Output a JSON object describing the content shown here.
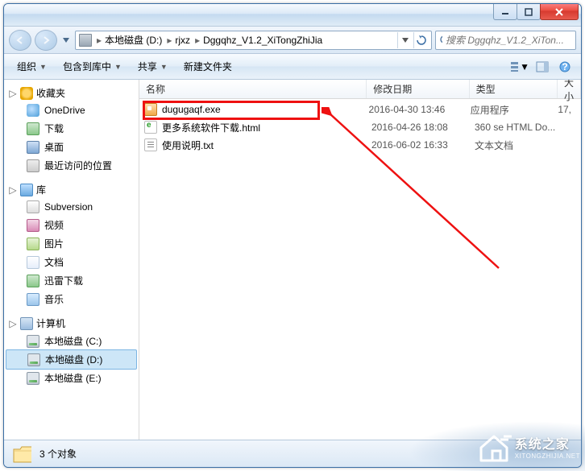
{
  "titlebar": {
    "min": "—",
    "max": "▢",
    "close": "✕"
  },
  "breadcrumbs": [
    "本地磁盘 (D:)",
    "rjxz",
    "Dggqhz_V1.2_XiTongZhiJia"
  ],
  "search": {
    "placeholder": "搜索 Dggqhz_V1.2_XiTon..."
  },
  "toolbar": {
    "organize": "组织",
    "include": "包含到库中",
    "share": "共享",
    "newfolder": "新建文件夹"
  },
  "columns": {
    "name": "名称",
    "date": "修改日期",
    "type": "类型",
    "size": "大小"
  },
  "sidebar": {
    "favorites": {
      "label": "收藏夹",
      "items": [
        {
          "label": "OneDrive",
          "icon": "ic-onedrive"
        },
        {
          "label": "下载",
          "icon": "ic-dl"
        },
        {
          "label": "桌面",
          "icon": "ic-desktop"
        },
        {
          "label": "最近访问的位置",
          "icon": "ic-recent"
        }
      ]
    },
    "libraries": {
      "label": "库",
      "items": [
        {
          "label": "Subversion",
          "icon": "ic-svn"
        },
        {
          "label": "视频",
          "icon": "ic-vid"
        },
        {
          "label": "图片",
          "icon": "ic-pic"
        },
        {
          "label": "文档",
          "icon": "ic-doc"
        },
        {
          "label": "迅雷下载",
          "icon": "ic-dl"
        },
        {
          "label": "音乐",
          "icon": "ic-music"
        }
      ]
    },
    "computer": {
      "label": "计算机",
      "items": [
        {
          "label": "本地磁盘 (C:)",
          "icon": "ic-drive"
        },
        {
          "label": "本地磁盘 (D:)",
          "icon": "ic-drive",
          "selected": true
        },
        {
          "label": "本地磁盘 (E:)",
          "icon": "ic-drive"
        }
      ]
    }
  },
  "files": [
    {
      "name": "dugugaqf.exe",
      "date": "2016-04-30 13:46",
      "type": "应用程序",
      "size": "17,",
      "icon": "ic-exe",
      "highlighted": true
    },
    {
      "name": "更多系统软件下载.html",
      "date": "2016-04-26 18:08",
      "type": "360 se HTML Do...",
      "size": "",
      "icon": "ic-html"
    },
    {
      "name": "使用说明.txt",
      "date": "2016-06-02 16:33",
      "type": "文本文档",
      "size": "",
      "icon": "ic-txt"
    }
  ],
  "status": {
    "count": "3 个对象"
  },
  "watermark": {
    "text": "系统之家",
    "sub": "XITONGZHIJIA.NET"
  }
}
